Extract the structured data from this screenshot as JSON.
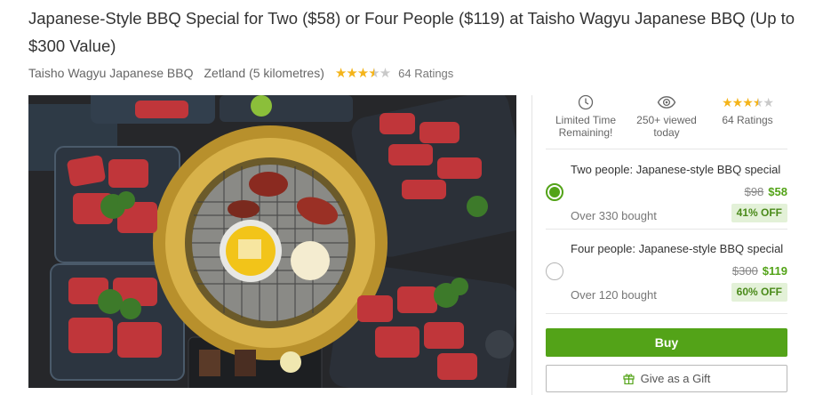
{
  "deal": {
    "title": "Japanese-Style BBQ Special for Two ($58) or Four People ($119) at Taisho Wagyu Japanese BBQ (Up to $300 Value)",
    "merchant": "Taisho Wagyu Japanese BBQ",
    "location": "Zetland (5 kilometres)",
    "rating_stars": 3.5,
    "ratings_label": "64 Ratings"
  },
  "stats": {
    "limited_time": "Limited Time Remaining!",
    "viewed": "250+ viewed today",
    "ratings": "64 Ratings"
  },
  "options": [
    {
      "title": "Two people: Japanese-style BBQ special",
      "old_price": "$98",
      "new_price": "$58",
      "bought": "Over 330 bought",
      "discount": "41% OFF",
      "selected": true
    },
    {
      "title": "Four people: Japanese-style BBQ special",
      "old_price": "$300",
      "new_price": "$119",
      "bought": "Over 120 bought",
      "discount": "60% OFF",
      "selected": false
    }
  ],
  "actions": {
    "buy": "Buy",
    "gift": "Give as a Gift"
  },
  "icons": {
    "clock": "clock-icon",
    "eye": "eye-icon",
    "gift": "gift-icon",
    "star": "star-icon"
  },
  "colors": {
    "accent": "#53a318",
    "star": "#f4b41a",
    "badge_bg": "#e3f1d8"
  }
}
